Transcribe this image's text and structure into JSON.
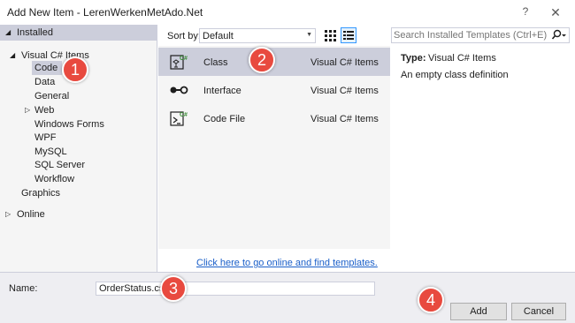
{
  "window": {
    "title": "Add New Item - LerenWerkenMetAdo.Net",
    "help_label": "?",
    "close_label": "✕"
  },
  "tree": {
    "installed": "Installed",
    "visual_cs_items": "Visual C# Items",
    "children": [
      "Code",
      "Data",
      "General",
      "Web",
      "Windows Forms",
      "WPF",
      "MySQL",
      "SQL Server",
      "Workflow"
    ],
    "graphics": "Graphics",
    "online": "Online",
    "selected": "Code"
  },
  "toolbar": {
    "sort_label": "Sort by:",
    "sort_value": "Default"
  },
  "templates": [
    {
      "name": "Class",
      "lang": "Visual C# Items",
      "icon": "class-icon",
      "selected": true
    },
    {
      "name": "Interface",
      "lang": "Visual C# Items",
      "icon": "interface-icon",
      "selected": false
    },
    {
      "name": "Code File",
      "lang": "Visual C# Items",
      "icon": "code-file-icon",
      "selected": false
    }
  ],
  "online_link": "Click here to go online and find templates.",
  "search": {
    "placeholder": "Search Installed Templates (Ctrl+E)"
  },
  "details": {
    "type_label": "Type:",
    "type_value": "Visual C# Items",
    "description": "An empty class definition"
  },
  "bottom": {
    "name_label": "Name:",
    "name_value": "OrderStatus.cs",
    "add_label": "Add",
    "cancel_label": "Cancel"
  },
  "callouts": [
    "1",
    "2",
    "3",
    "4"
  ],
  "colors": {
    "selection": "#cccedb",
    "callout": "#e84a3f",
    "link": "#1a5fc9",
    "pane_bg": "#f5f5f5"
  }
}
